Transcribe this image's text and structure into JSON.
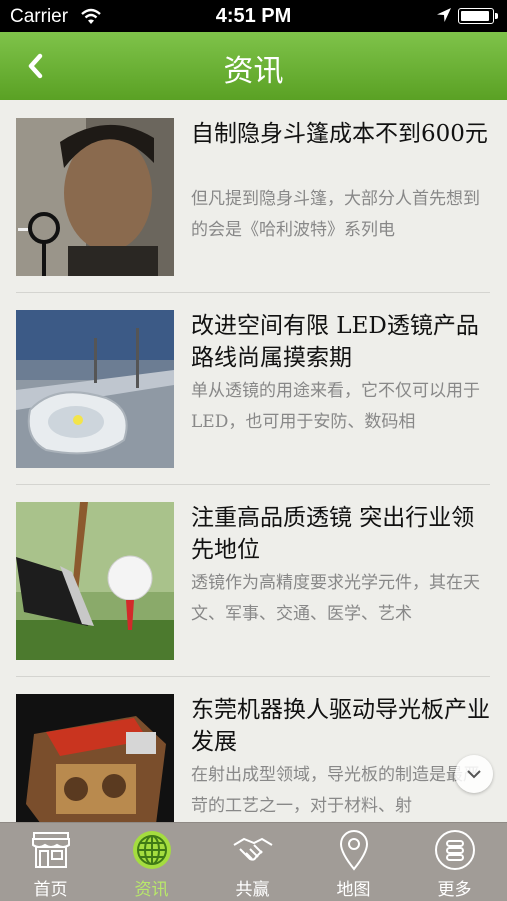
{
  "status": {
    "carrier": "Carrier",
    "time": "4:51 PM"
  },
  "header": {
    "title": "资讯"
  },
  "articles": [
    {
      "title": "自制隐身斗篷成本不到600元",
      "summary": "但凡提到隐身斗篷，大部分人首先想到的会是《哈利波特》系列电"
    },
    {
      "title": "改进空间有限 LED透镜产品路线尚属摸索期",
      "summary": "单从透镜的用途来看，它不仅可以用于LED，也可用于安防、数码相"
    },
    {
      "title": "注重高品质透镜 突出行业领先地位",
      "summary": "透镜作为高精度要求光学元件，其在天文、军事、交通、医学、艺术"
    },
    {
      "title": "东莞机器换人驱动导光板产业发展",
      "summary": "在射出成型领域，导光板的制造是最严苛的工艺之一，对于材料、射"
    }
  ],
  "tabs": [
    {
      "label": "首页",
      "icon": "store-icon"
    },
    {
      "label": "资讯",
      "icon": "globe-icon",
      "active": true
    },
    {
      "label": "共赢",
      "icon": "handshake-icon"
    },
    {
      "label": "地图",
      "icon": "map-pin-icon"
    },
    {
      "label": "更多",
      "icon": "more-icon"
    }
  ],
  "colors": {
    "header": "#6cb236",
    "tabbar": "#a19c97",
    "tab_active": "#b8e86a"
  }
}
